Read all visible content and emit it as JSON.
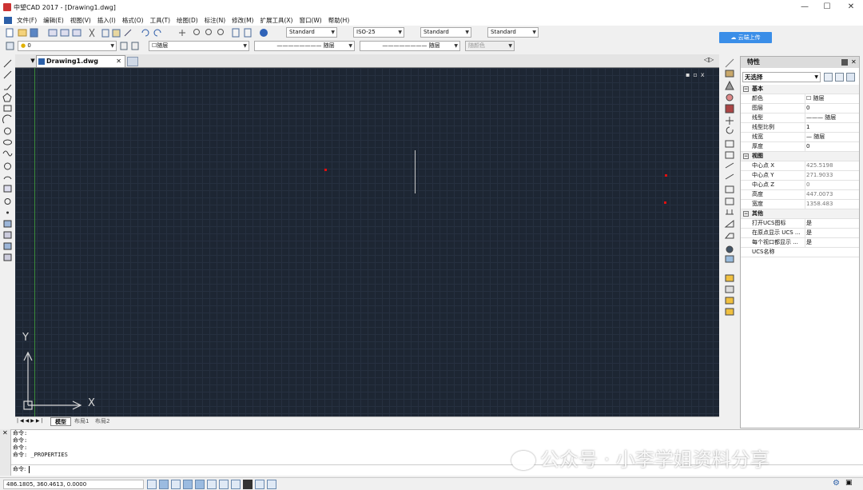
{
  "window": {
    "title": "中望CAD 2017 - [Drawing1.dwg]",
    "minimize": "—",
    "maximize": "☐",
    "close": "✕"
  },
  "menu": [
    "文件(F)",
    "编辑(E)",
    "视图(V)",
    "插入(I)",
    "格式(O)",
    "工具(T)",
    "绘图(D)",
    "标注(N)",
    "修改(M)",
    "扩展工具(X)",
    "窗口(W)",
    "帮助(H)"
  ],
  "toolbar": {
    "text_style": "Standard",
    "dim_style": "ISO-25",
    "table_style": "Standard",
    "mleader_style": "Standard",
    "cloud_button": "云端上传"
  },
  "layers": {
    "current": "0",
    "color": "随层",
    "linetype": "随层",
    "lineweight": "随层",
    "plotstyle": "随颜色"
  },
  "tabs": {
    "document": "Drawing1.dwg",
    "layout_tabs": [
      "模型",
      "布局1",
      "布局2"
    ]
  },
  "ucs": {
    "x_label": "X",
    "y_label": "Y"
  },
  "viewport_controls": [
    "▪",
    "▫",
    "x"
  ],
  "properties": {
    "title": "特性",
    "selection": "无选择",
    "categories": [
      {
        "name": "基本",
        "rows": [
          [
            "颜色",
            "☐ 随层"
          ],
          [
            "图层",
            "0"
          ],
          [
            "线型",
            "——— 随层"
          ],
          [
            "线型比例",
            "1"
          ],
          [
            "线宽",
            "— 随层"
          ],
          [
            "厚度",
            "0"
          ]
        ]
      },
      {
        "name": "视图",
        "rows": [
          [
            "中心点 X",
            "425.5198"
          ],
          [
            "中心点 Y",
            "271.9033"
          ],
          [
            "中心点 Z",
            "0"
          ],
          [
            "高度",
            "447.0073"
          ],
          [
            "宽度",
            "1358.483"
          ]
        ]
      },
      {
        "name": "其他",
        "rows": [
          [
            "打开UCS图标",
            "是"
          ],
          [
            "在原点显示 UCS ...",
            "是"
          ],
          [
            "每个视口都显示 ...",
            "是"
          ],
          [
            "UCS名称",
            ""
          ]
        ]
      }
    ]
  },
  "command": {
    "lines": [
      "命令:",
      "命令:",
      "命令:",
      "命令: _PROPERTIES"
    ],
    "prompt": "命令:"
  },
  "status": {
    "coords": "486.1805, 360.4613, 0.0000"
  },
  "watermark": "公众号 · 小李学姐资料分享",
  "colors": {
    "canvas": "#1d2633",
    "accent": "#e01010",
    "ucs": "#d8d8d8"
  }
}
